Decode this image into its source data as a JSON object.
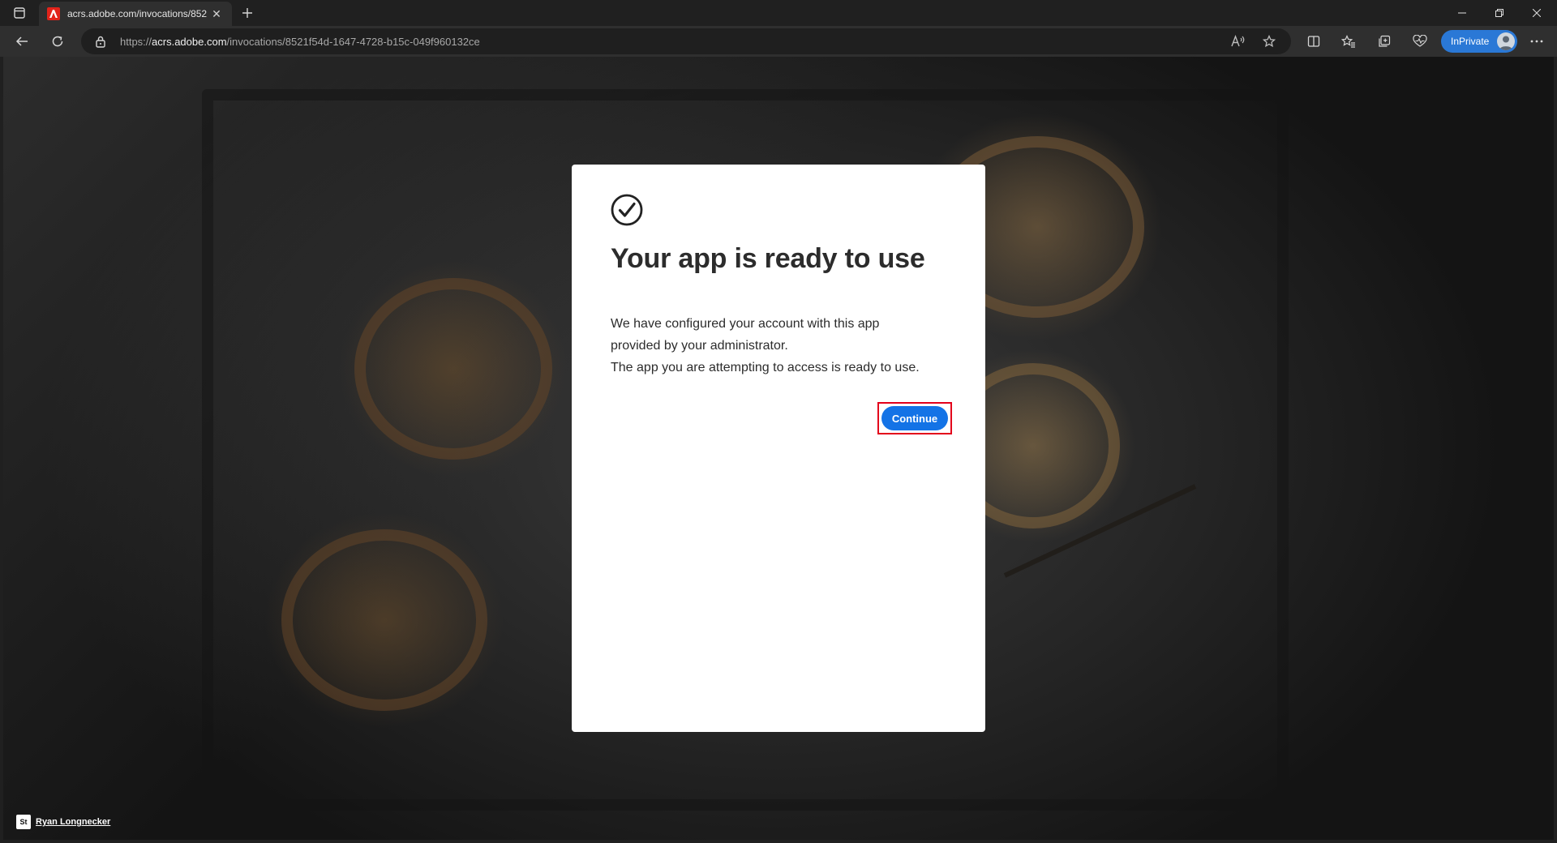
{
  "tab": {
    "title": "acrs.adobe.com/invocations/852",
    "close_glyph": "✕"
  },
  "address_bar": {
    "url_prefix": "https://",
    "url_host": "acrs.adobe.com",
    "url_path": "/invocations/8521f54d-1647-4728-b15c-049f960132ce"
  },
  "inprivate": {
    "label": "InPrivate"
  },
  "dialog": {
    "title": "Your app is ready to use",
    "body_lines": [
      "We have configured your account with this app",
      "provided by your administrator.",
      "The app you are attempting to access is ready to use."
    ],
    "continue_label": "Continue"
  },
  "credit": {
    "logo_text": "St",
    "name": "Ryan Longnecker"
  },
  "colors": {
    "accent": "#1473e6",
    "highlight": "#e3001b",
    "inprivate": "#2a78d6"
  }
}
